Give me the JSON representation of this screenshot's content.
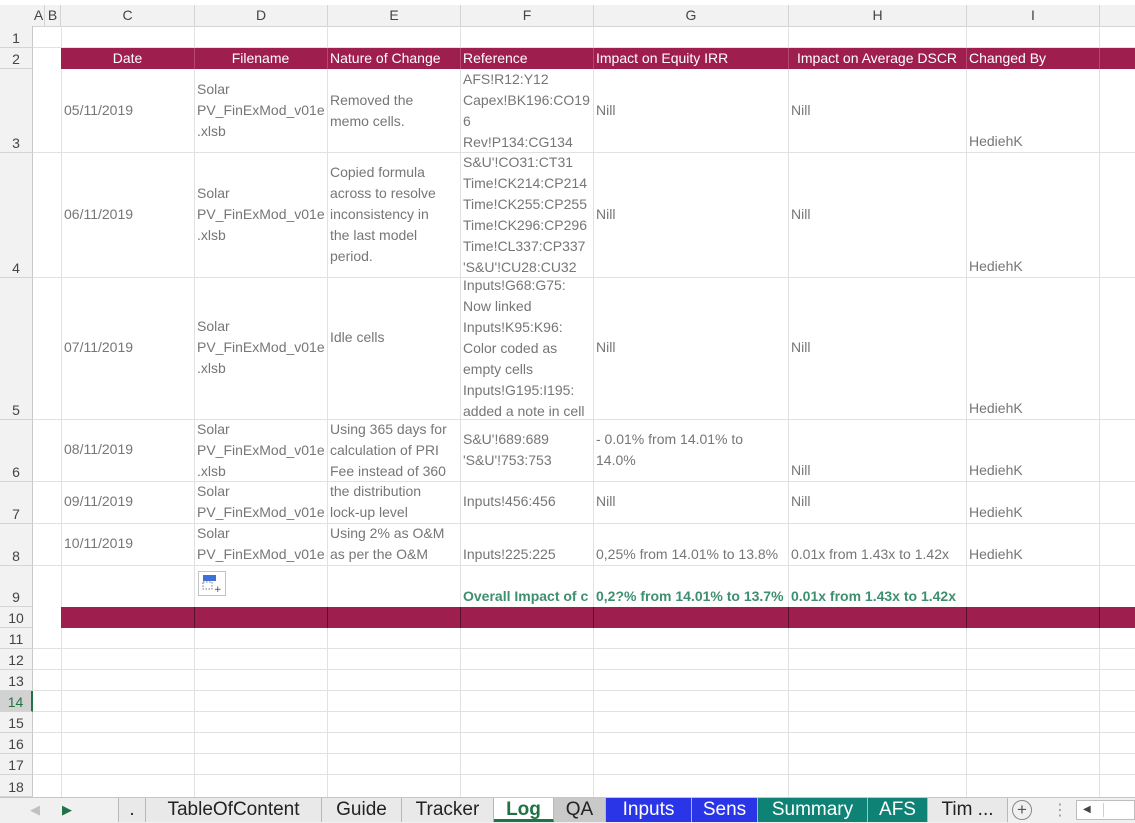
{
  "columns": [
    "A",
    "B",
    "C",
    "D",
    "E",
    "F",
    "G",
    "H",
    "I"
  ],
  "rows": [
    "1",
    "2",
    "3",
    "4",
    "5",
    "6",
    "7",
    "8",
    "9",
    "10",
    "11",
    "12",
    "13",
    "14",
    "15",
    "16",
    "17",
    "18"
  ],
  "selected_row": "14",
  "accent_color": "#9e1f4e",
  "headers": {
    "date": "Date",
    "filename": "Filename",
    "nature": "Nature of Change",
    "reference": "Reference",
    "irr": "Impact on Equity IRR",
    "dscr": "Impact on Average DSCR",
    "changed_by": "Changed By"
  },
  "log": [
    {
      "date": "05/11/2019",
      "filename": "Solar\nPV_FinExMod_v01e\n.xlsb",
      "nature": "Removed the\nmemo cells.",
      "reference": "AFS!R12:Y12\nCapex!BK196:CO19\n6\nRev!P134:CG134",
      "irr": "Nill",
      "dscr": "Nill",
      "changed_by": "HediehK"
    },
    {
      "date": "06/11/2019",
      "filename": "Solar\nPV_FinExMod_v01e\n.xlsb",
      "nature": "Copied formula\nacross to resolve\ninconsistency in\nthe last model\nperiod.",
      "reference": "S&U'!CO31:CT31\nTime!CK214:CP214\nTime!CK255:CP255\nTime!CK296:CP296\nTime!CL337:CP337\n'S&U'!CU28:CU32",
      "irr": "Nill",
      "dscr": "Nill",
      "changed_by": "HediehK"
    },
    {
      "date": "07/11/2019",
      "filename": "Solar\nPV_FinExMod_v01e\n.xlsb",
      "nature": "Idle cells",
      "reference": "Inputs!G68:G75:\nNow linked\nInputs!K95:K96:\nColor coded as\nempty cells\nInputs!G195:I195:\nadded a note in cell",
      "irr": "Nill",
      "dscr": "Nill",
      "changed_by": "HediehK"
    },
    {
      "date": "08/11/2019",
      "filename": "Solar\nPV_FinExMod_v01e\n.xlsb",
      "nature": "Using 365 days for\ncalculation of PRI\nFee instead of 360",
      "reference": "S&U'!689:689\n'S&U'!753:753",
      "irr": "- 0.01% from 14.01% to\n14.0%",
      "dscr": "Nill",
      "changed_by": "HediehK"
    },
    {
      "date": "09/11/2019",
      "filename": "Solar\nPV_FinExMod_v01e",
      "nature": "the distribution\nlock-up level",
      "reference": "Inputs!456:456",
      "irr": "Nill",
      "dscr": "Nill",
      "changed_by": "HediehK"
    },
    {
      "date": "10/11/2019",
      "filename": "Solar\nPV_FinExMod_v01e",
      "nature": "Using 2% as O&M\nas per the O&M",
      "reference": "Inputs!225:225",
      "irr": "0,25% from 14.01% to 13.8%",
      "dscr": "0.01x from 1.43x to 1.42x",
      "changed_by": "HediehK"
    }
  ],
  "overall": {
    "label": "Overall Impact of c",
    "irr": "0,2?% from 14.01% to 13.7%",
    "dscr": "0.01x from 1.43x to 1.42x"
  },
  "icons": {
    "paste_options": "paste-options-icon",
    "nav_prev": "triangle-left-icon",
    "nav_next": "triangle-right-icon",
    "add_sheet": "plus-circle-icon",
    "scroll_left": "scroll-left-icon"
  },
  "tabs": [
    {
      "label": ".",
      "bg": "#e9e9e9",
      "color": "#222222"
    },
    {
      "label": "TableOfContent",
      "bg": "#e9e9e9",
      "color": "#222222"
    },
    {
      "label": "Guide",
      "bg": "#e9e9e9",
      "color": "#222222"
    },
    {
      "label": "Tracker",
      "bg": "#e9e9e9",
      "color": "#222222"
    },
    {
      "label": "Log",
      "bg": "#ffffff",
      "color": "#217346",
      "active": true
    },
    {
      "label": "QA",
      "bg": "#c9c9c9",
      "color": "#222222"
    },
    {
      "label": "Inputs",
      "bg": "#2a35e8",
      "color": "#ffffff"
    },
    {
      "label": "Sens",
      "bg": "#2a35e8",
      "color": "#ffffff"
    },
    {
      "label": "Summary",
      "bg": "#0e8275",
      "color": "#ffffff"
    },
    {
      "label": "AFS",
      "bg": "#0e8275",
      "color": "#ffffff"
    },
    {
      "label": "Tim ...",
      "bg": "#e9e9e9",
      "color": "#222222"
    }
  ]
}
